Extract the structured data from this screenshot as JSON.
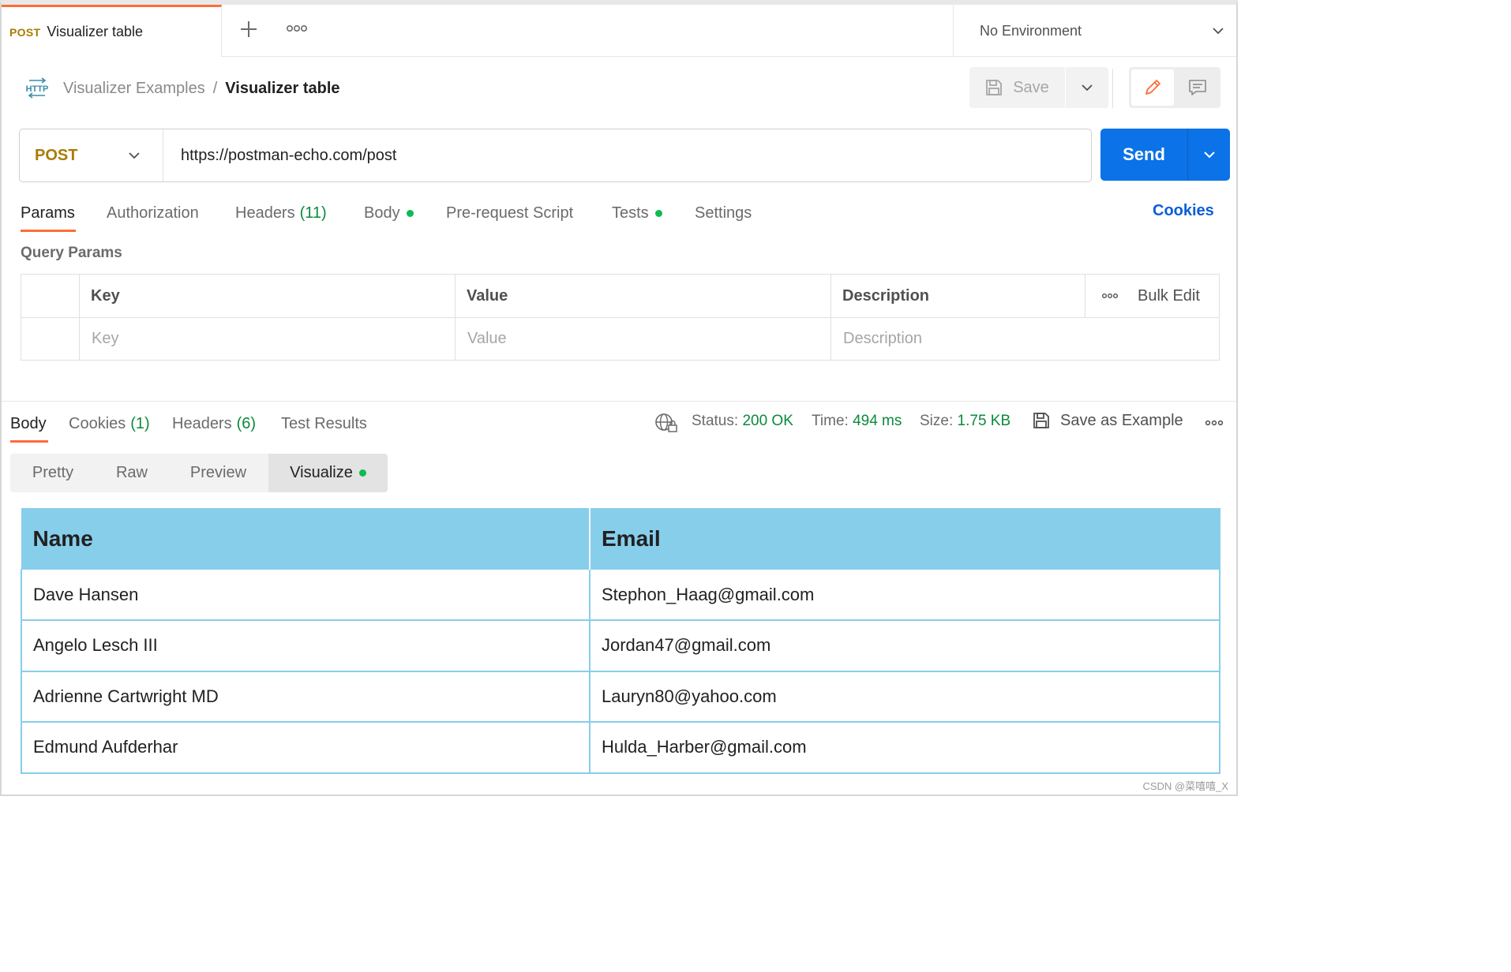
{
  "tabbar": {
    "active_tab": {
      "method": "POST",
      "title": "Visualizer table"
    },
    "environment": "No Environment"
  },
  "breadcrumb": {
    "icon_text": "HTTP",
    "parent": "Visualizer Examples",
    "separator": "/",
    "current": "Visualizer table"
  },
  "toolbar": {
    "save_label": "Save"
  },
  "request": {
    "method": "POST",
    "url": "https://postman-echo.com/post",
    "send_label": "Send"
  },
  "request_tabs": [
    {
      "label": "Params",
      "count": "",
      "dot": false
    },
    {
      "label": "Authorization",
      "count": "",
      "dot": false
    },
    {
      "label": "Headers",
      "count": "(11)",
      "dot": false
    },
    {
      "label": "Body",
      "count": "",
      "dot": true
    },
    {
      "label": "Pre-request Script",
      "count": "",
      "dot": false
    },
    {
      "label": "Tests",
      "count": "",
      "dot": true
    },
    {
      "label": "Settings",
      "count": "",
      "dot": false
    }
  ],
  "cookies_link": "Cookies",
  "query_params": {
    "title": "Query Params",
    "headers": {
      "key": "Key",
      "value": "Value",
      "description": "Description",
      "bulk_edit": "Bulk Edit"
    },
    "placeholders": {
      "key": "Key",
      "value": "Value",
      "description": "Description"
    }
  },
  "response": {
    "tabs": [
      {
        "label": "Body",
        "count": ""
      },
      {
        "label": "Cookies",
        "count": "(1)"
      },
      {
        "label": "Headers",
        "count": "(6)"
      },
      {
        "label": "Test Results",
        "count": ""
      }
    ],
    "status_label": "Status:",
    "status_value": "200 OK",
    "time_label": "Time:",
    "time_value": "494 ms",
    "size_label": "Size:",
    "size_value": "1.75 KB",
    "save_example": "Save as Example",
    "formats": [
      "Pretty",
      "Raw",
      "Preview",
      "Visualize"
    ]
  },
  "visualizer_table": {
    "headers": [
      "Name",
      "Email"
    ],
    "rows": [
      [
        "Dave Hansen",
        "Stephon_Haag@gmail.com"
      ],
      [
        "Angelo Lesch III",
        "Jordan47@gmail.com"
      ],
      [
        "Adrienne Cartwright MD",
        "Lauryn80@yahoo.com"
      ],
      [
        "Edmund Aufderhar",
        "Hulda_Harber@gmail.com"
      ]
    ]
  },
  "watermark": "CSDN @菜嘻嘻_X",
  "colors": {
    "accent": "#ff6c37",
    "send": "#0b72e7",
    "method": "#a97c00",
    "success": "#0a8a3b",
    "table_header": "#87ceeb"
  }
}
